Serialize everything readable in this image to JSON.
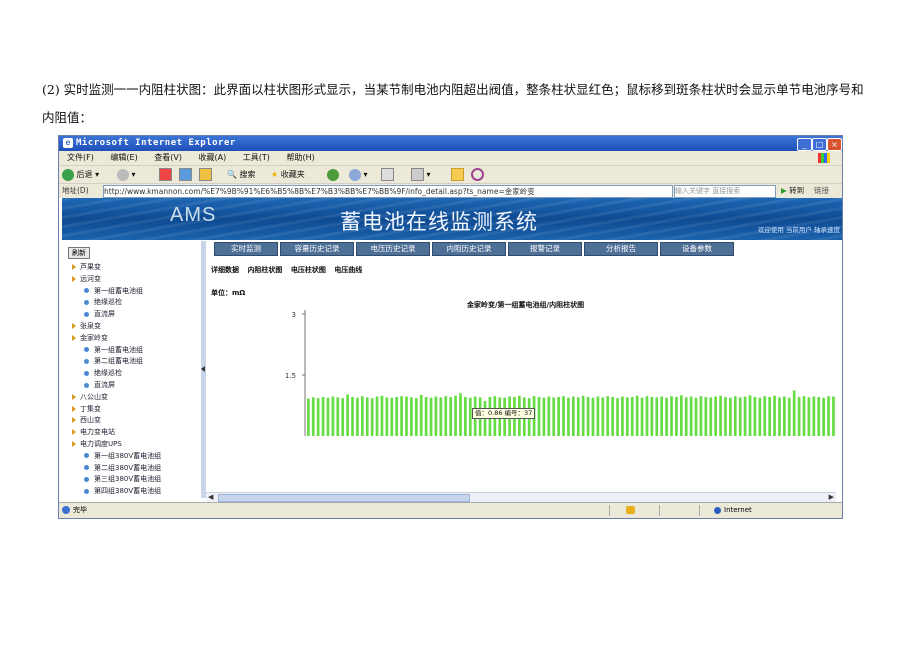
{
  "paragraph": "(2) 实时监测一一内阻柱状图：此界面以柱状图形式显示，当某节制电池内阻超出阀值，整条柱状显红色；鼠标移到斑条柱状时会显示单节电池序号和内阻值：",
  "window": {
    "title": "Microsoft Internet Explorer",
    "controls": [
      "_",
      "□",
      "×"
    ]
  },
  "menu": [
    "文件(F)",
    "编辑(E)",
    "查看(V)",
    "收藏(A)",
    "工具(T)",
    "帮助(H)"
  ],
  "toolbar": {
    "back": "后退",
    "search": "搜索",
    "favorites": "收藏夹"
  },
  "address": {
    "label": "地址(D)",
    "url": "http://www.kmannon.com/%E7%9B%91%E6%B5%8B%E7%B3%BB%E7%BB%9F/info_detail.asp?ts_name=金家岭变",
    "search_placeholder": "输入关键字 直接搜索",
    "go": "转到",
    "links": "链接"
  },
  "banner": {
    "logo": "AMS",
    "system_name": "蓄电池在线监测系统",
    "right_text": "欢迎使用 当前用户 轴承速度"
  },
  "sidebar": {
    "refresh": "刷新",
    "items": [
      {
        "label": "芦果变",
        "level": 0
      },
      {
        "label": "远河变",
        "level": 0
      },
      {
        "label": "第一组蓄电池组",
        "level": 1
      },
      {
        "label": "绝缘巡检",
        "level": 1
      },
      {
        "label": "直流屏",
        "level": 1
      },
      {
        "label": "张泉变",
        "level": 0
      },
      {
        "label": "金家岭变",
        "level": 0
      },
      {
        "label": "第一组蓄电池组",
        "level": 1
      },
      {
        "label": "第二组蓄电池组",
        "level": 1
      },
      {
        "label": "绝缘巡检",
        "level": 1
      },
      {
        "label": "直流屏",
        "level": 1
      },
      {
        "label": "八公山变",
        "level": 0
      },
      {
        "label": "丁集变",
        "level": 0
      },
      {
        "label": "西山变",
        "level": 0
      },
      {
        "label": "电力变电站",
        "level": 0
      },
      {
        "label": "电力调度UPS",
        "level": 0
      },
      {
        "label": "第一组380V蓄电池组",
        "level": 1
      },
      {
        "label": "第二组380V蓄电池组",
        "level": 1
      },
      {
        "label": "第三组380V蓄电池组",
        "level": 1
      },
      {
        "label": "第四组380V蓄电池组",
        "level": 1
      }
    ]
  },
  "tabs": [
    "实时监测",
    "容量历史记录",
    "电压历史记录",
    "内阻历史记录",
    "报警记录",
    "分析报告",
    "设备参数"
  ],
  "subnav": [
    "详细数据",
    "内阻柱状图",
    "电压柱状图",
    "电压曲线"
  ],
  "unit_label": "单位：mΩ",
  "tooltip": "值：0.86 编号：37",
  "status": {
    "text": "完毕",
    "zone": "Internet"
  },
  "colors": {
    "bar": "#66dd44",
    "titlebar": "#1f4fb8",
    "banner": "#0d4a92",
    "tab": "#4e6f96"
  },
  "chart_data": {
    "type": "bar",
    "title": "金家岭变/第一组蓄电池组/内阻柱状图",
    "ylabel": "单位：mΩ",
    "y_ticks": [
      "3",
      "1.5"
    ],
    "ylim": [
      0,
      3
    ],
    "series": [
      {
        "values": [
          0.92,
          0.95,
          0.93,
          0.96,
          0.94,
          0.97,
          0.95,
          0.93,
          1.02,
          0.96,
          0.94,
          0.98,
          0.95,
          0.93,
          0.97,
          0.99,
          0.95,
          0.94,
          0.96,
          0.98,
          0.97,
          0.95,
          0.93,
          1.01,
          0.96,
          0.94,
          0.97,
          0.95,
          0.98,
          0.96,
          0.99,
          1.05,
          0.96,
          0.94,
          0.97,
          0.95,
          0.86,
          0.96,
          0.98,
          0.95,
          0.94,
          0.97,
          0.96,
          0.99,
          0.95,
          0.93,
          0.98,
          0.96,
          0.94,
          0.97,
          0.95,
          0.96,
          0.98,
          0.94,
          0.97,
          0.95,
          0.99,
          0.96,
          0.94,
          0.97,
          0.95,
          0.98,
          0.96,
          0.93,
          0.97,
          0.95,
          0.96,
          0.99,
          0.94,
          0.98,
          0.96,
          0.95,
          0.97,
          0.94,
          0.98,
          0.96,
          1.0,
          0.95,
          0.97,
          0.94,
          0.98,
          0.96,
          0.95,
          0.97,
          0.99,
          0.96,
          0.94,
          0.98,
          0.95,
          0.97,
          1.0,
          0.96,
          0.94,
          0.98,
          0.96,
          0.99,
          0.95,
          0.97,
          0.94,
          1.12,
          0.96,
          0.98,
          0.95,
          0.97,
          0.96,
          0.94,
          0.98,
          0.97
        ]
      }
    ]
  }
}
